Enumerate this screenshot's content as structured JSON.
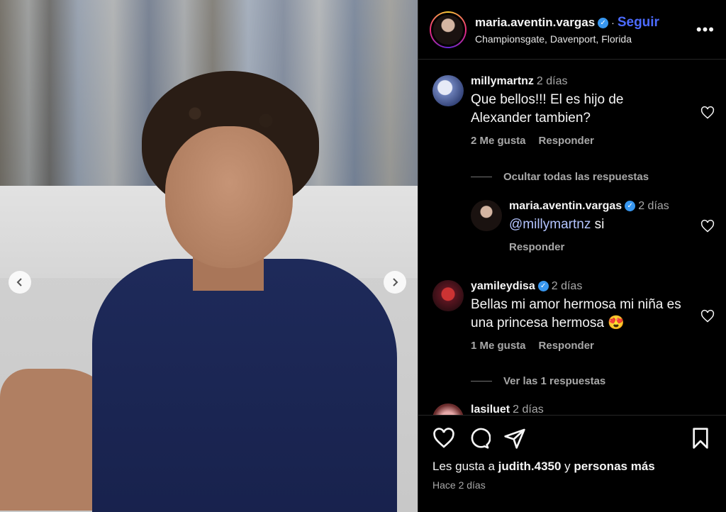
{
  "post": {
    "author": "maria.aventin.vargas",
    "follow_label": "Seguir",
    "separator": "·",
    "location": "Championsgate, Davenport, Florida",
    "more_label": "•••",
    "image_prev_icon": "chevron-left-icon",
    "image_next_icon": "chevron-right-icon"
  },
  "comments": [
    {
      "user": "millymartnz",
      "time": "2 días",
      "text": "Que bellos!!! El es hijo de Alexander tambien?",
      "likes": "2 Me gusta",
      "reply_label": "Responder",
      "toggle": "Ocultar todas las respuestas",
      "replies": [
        {
          "user": "maria.aventin.vargas",
          "time": "2 días",
          "mention": "@millymartnz",
          "text": " si",
          "reply_label": "Responder"
        }
      ]
    },
    {
      "user": "yamileydisa",
      "time": "2 días",
      "text": "Bellas mi amor hermosa mi niña es una princesa hermosa",
      "emoji": "😍",
      "likes": "1 Me gusta",
      "reply_label": "Responder",
      "toggle": "Ver las 1 respuestas"
    },
    {
      "user": "lasiluet",
      "time": "2 días"
    }
  ],
  "footer": {
    "likes_prefix": "Les gusta a ",
    "likes_user": "judith.4350",
    "likes_middle": " y ",
    "likes_suffix": "personas más",
    "time": "Hace 2 días"
  },
  "colors": {
    "accent": "#4c6bff",
    "verified": "#3897f0",
    "muted": "#a8a8a8"
  }
}
